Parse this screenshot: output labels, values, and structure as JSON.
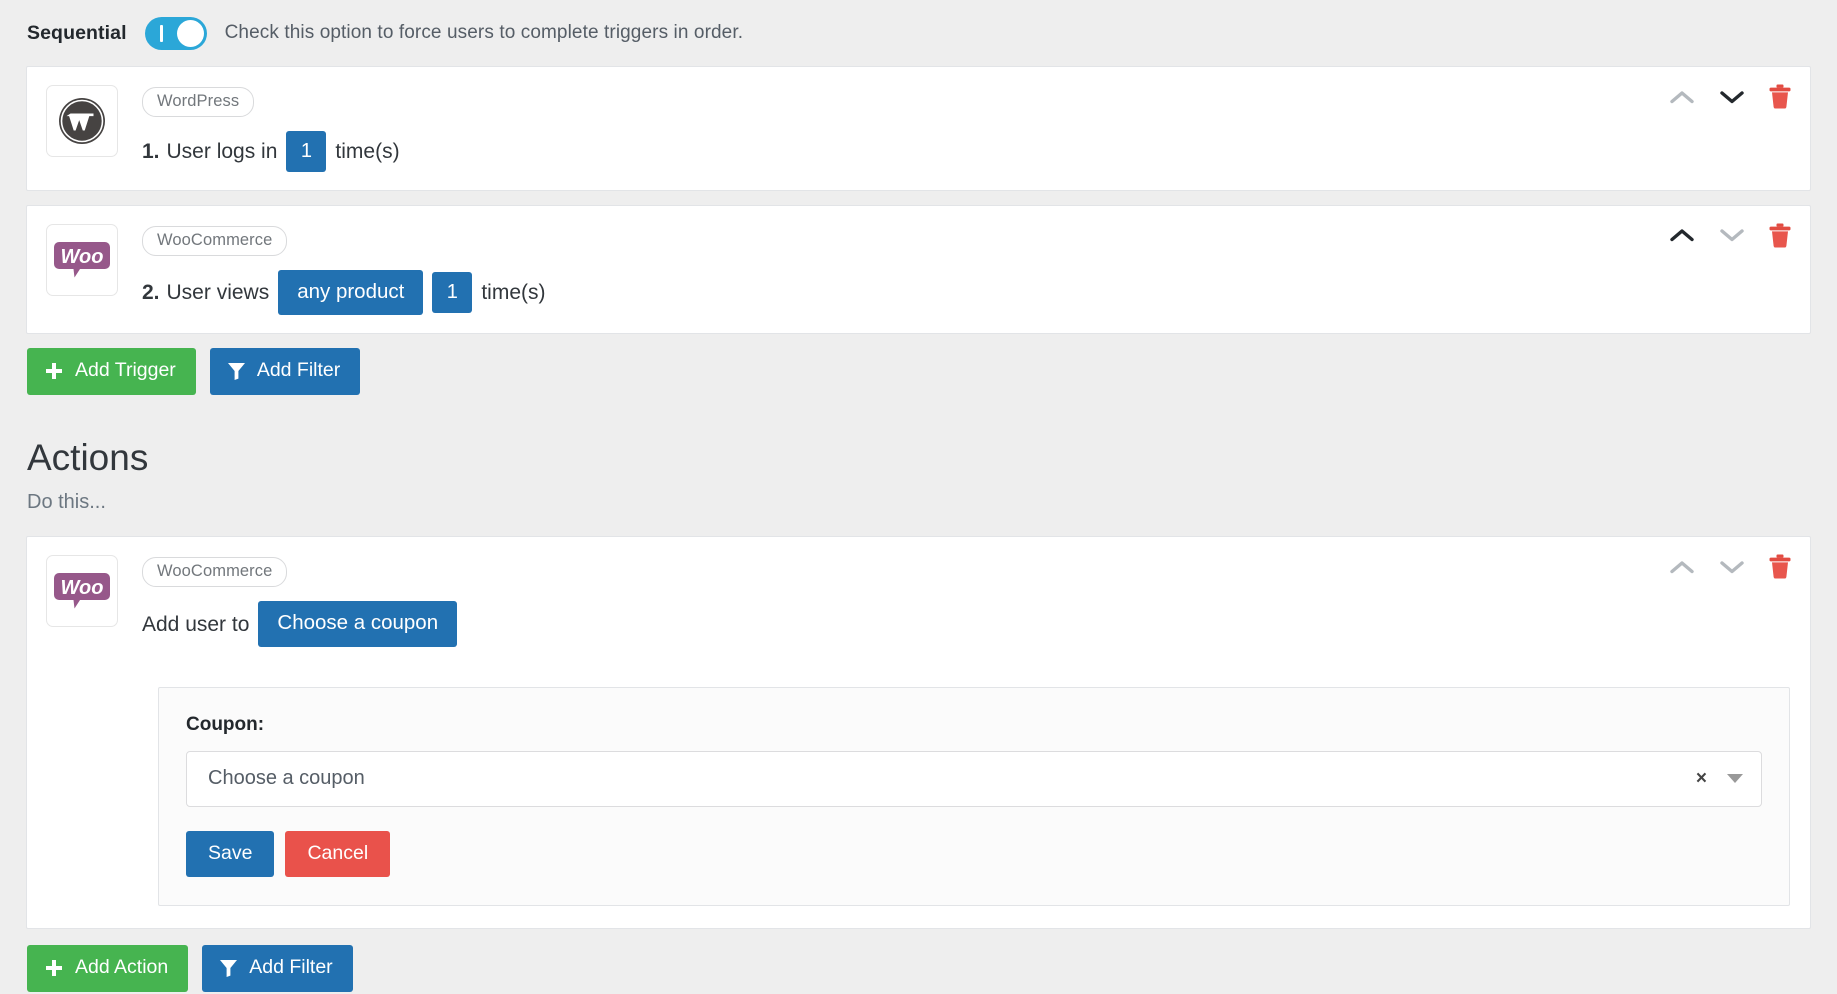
{
  "sequential": {
    "label": "Sequential",
    "toggle_on": true,
    "toggle_name": "sequential-toggle",
    "help_text": "Check this option to force users to complete triggers in order."
  },
  "triggers": [
    {
      "integration": "WordPress",
      "logo": "wordpress-logo",
      "number": "1.",
      "text_before": "User logs in",
      "token_value": "1",
      "text_after": "time(s)",
      "has_middle_token": false,
      "up_enabled": false,
      "down_enabled": true
    },
    {
      "integration": "WooCommerce",
      "logo": "woocommerce-logo",
      "number": "2.",
      "text_before": "User views",
      "middle_token": "any product",
      "token_value": "1",
      "text_after": "time(s)",
      "has_middle_token": true,
      "up_enabled": true,
      "down_enabled": false
    }
  ],
  "trigger_buttons": {
    "add_trigger": "Add Trigger",
    "add_filter": "Add Filter"
  },
  "actions_section": {
    "title": "Actions",
    "subtitle": "Do this..."
  },
  "action": {
    "integration": "WooCommerce",
    "logo": "woocommerce-logo",
    "text_before": "Add user to",
    "token": "Choose a coupon",
    "up_enabled": false,
    "down_enabled": false,
    "panel": {
      "field_label": "Coupon:",
      "select_placeholder": "Choose a coupon",
      "clear_glyph": "×",
      "save_label": "Save",
      "cancel_label": "Cancel"
    }
  },
  "action_buttons": {
    "add_action": "Add Action",
    "add_filter": "Add Filter"
  },
  "colors": {
    "accent_blue": "#2271b1",
    "green": "#46b450",
    "red": "#e9524b",
    "toggle_blue": "#2ba7d8",
    "woo_purple": "#96588a"
  }
}
